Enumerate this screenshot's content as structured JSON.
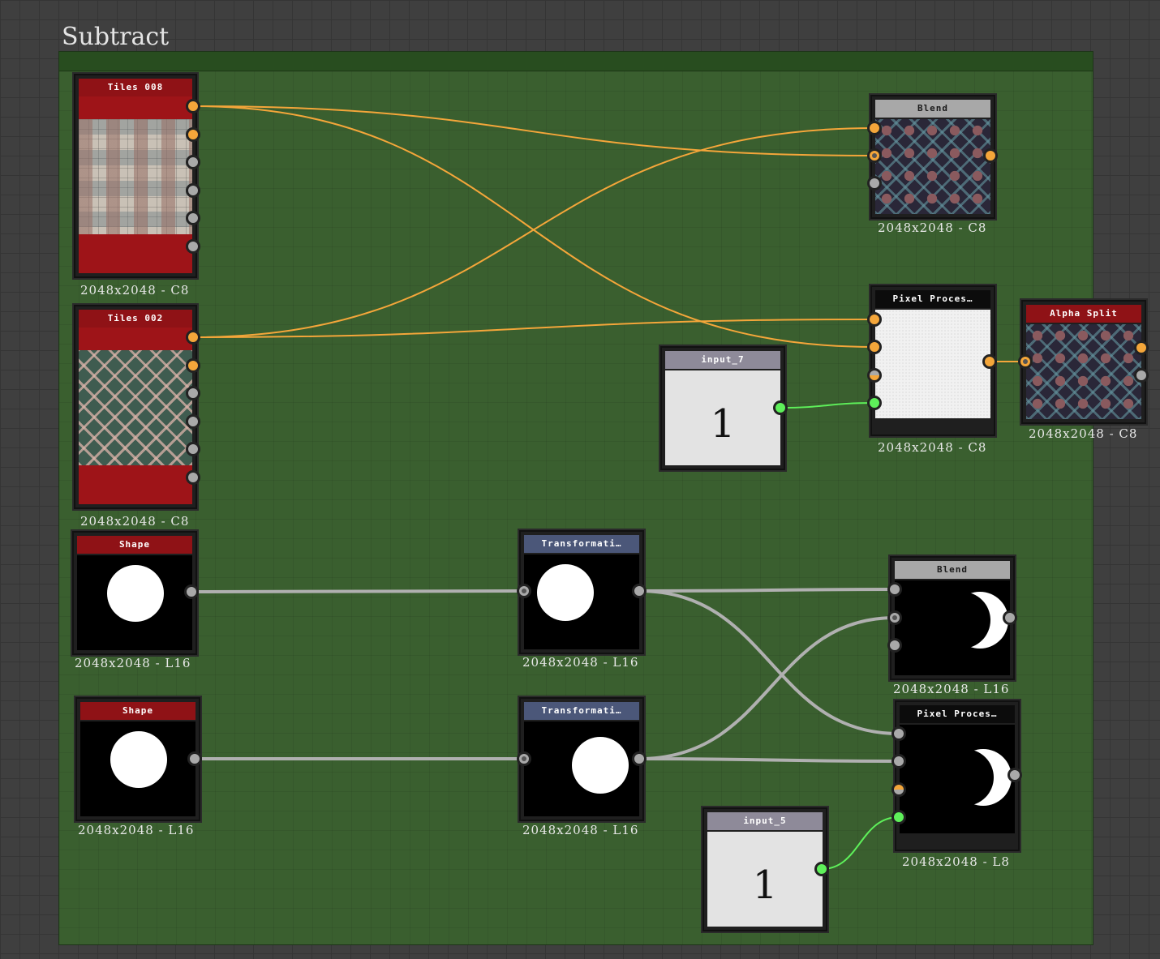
{
  "frame": {
    "title": "Subtract"
  },
  "colors": {
    "frame_bg": "#3a5f2f",
    "wire_color": "#f4a63a",
    "wire_gray": "#b0b0b0",
    "wire_green": "#5ef05a"
  },
  "nodes": {
    "tiles008": {
      "title": "Tiles 008",
      "info": "2048x2048 - C8"
    },
    "tiles002": {
      "title": "Tiles 002",
      "info": "2048x2048 - C8"
    },
    "blend_top": {
      "title": "Blend",
      "info": "2048x2048 - C8"
    },
    "pixel_top": {
      "title": "Pixel Proces…",
      "info": "2048x2048 - C8"
    },
    "alpha_split": {
      "title": "Alpha Split",
      "info": "2048x2048 - C8"
    },
    "input7": {
      "title": "input_7",
      "value": "1"
    },
    "shape1": {
      "title": "Shape",
      "info": "2048x2048 - L16"
    },
    "shape2": {
      "title": "Shape",
      "info": "2048x2048 - L16"
    },
    "transform1": {
      "title": "Transformati…",
      "info": "2048x2048 - L16"
    },
    "transform2": {
      "title": "Transformati…",
      "info": "2048x2048 - L16"
    },
    "blend_bottom": {
      "title": "Blend",
      "info": "2048x2048 - L16"
    },
    "pixel_bottom": {
      "title": "Pixel Proces…",
      "info": "2048x2048 - L8"
    },
    "input5": {
      "title": "input_5",
      "value": "1"
    }
  }
}
